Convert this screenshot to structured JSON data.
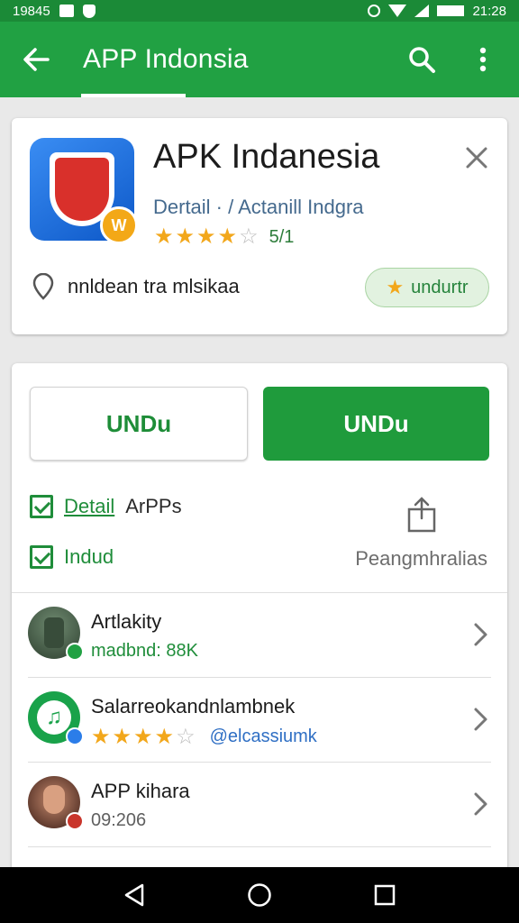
{
  "status_bar": {
    "time_left": "19845",
    "time_right": "21:28"
  },
  "app_bar": {
    "title": "APP Indonsia",
    "back_icon": "arrow-back-icon",
    "search_icon": "search-icon",
    "menu_icon": "more-vert-icon"
  },
  "app_card": {
    "name": "APK Indanesia",
    "subtitle": "Dertail · / Actanill Indgra",
    "rating_stars": 4,
    "rating_text": "5/1",
    "description": "nnldean tra mlsikaa",
    "chip_label": "undur​​tr"
  },
  "actions": {
    "secondary_label": "UNDu",
    "primary_label": "UNDu",
    "check_1_link": "Detail",
    "check_1_text": "ArPPs",
    "check_2_text": "Indud",
    "share_label": "Peangmhralias"
  },
  "list": [
    {
      "title": "Artlakity",
      "subtitle": "madbnd: 88K",
      "sub_style": "green",
      "badge": "green"
    },
    {
      "title": "Salarreokandnlambnek",
      "rating_stars": 4,
      "handle": "@elcassiumk",
      "badge": "blue"
    },
    {
      "title": "APP kihara",
      "subtitle": "09:206",
      "sub_style": "grey",
      "badge": "red"
    }
  ],
  "colors": {
    "primary": "#21a143",
    "status_bar": "#1b8a37",
    "star": "#f2a71b",
    "accent_text": "#1f8d3a"
  }
}
